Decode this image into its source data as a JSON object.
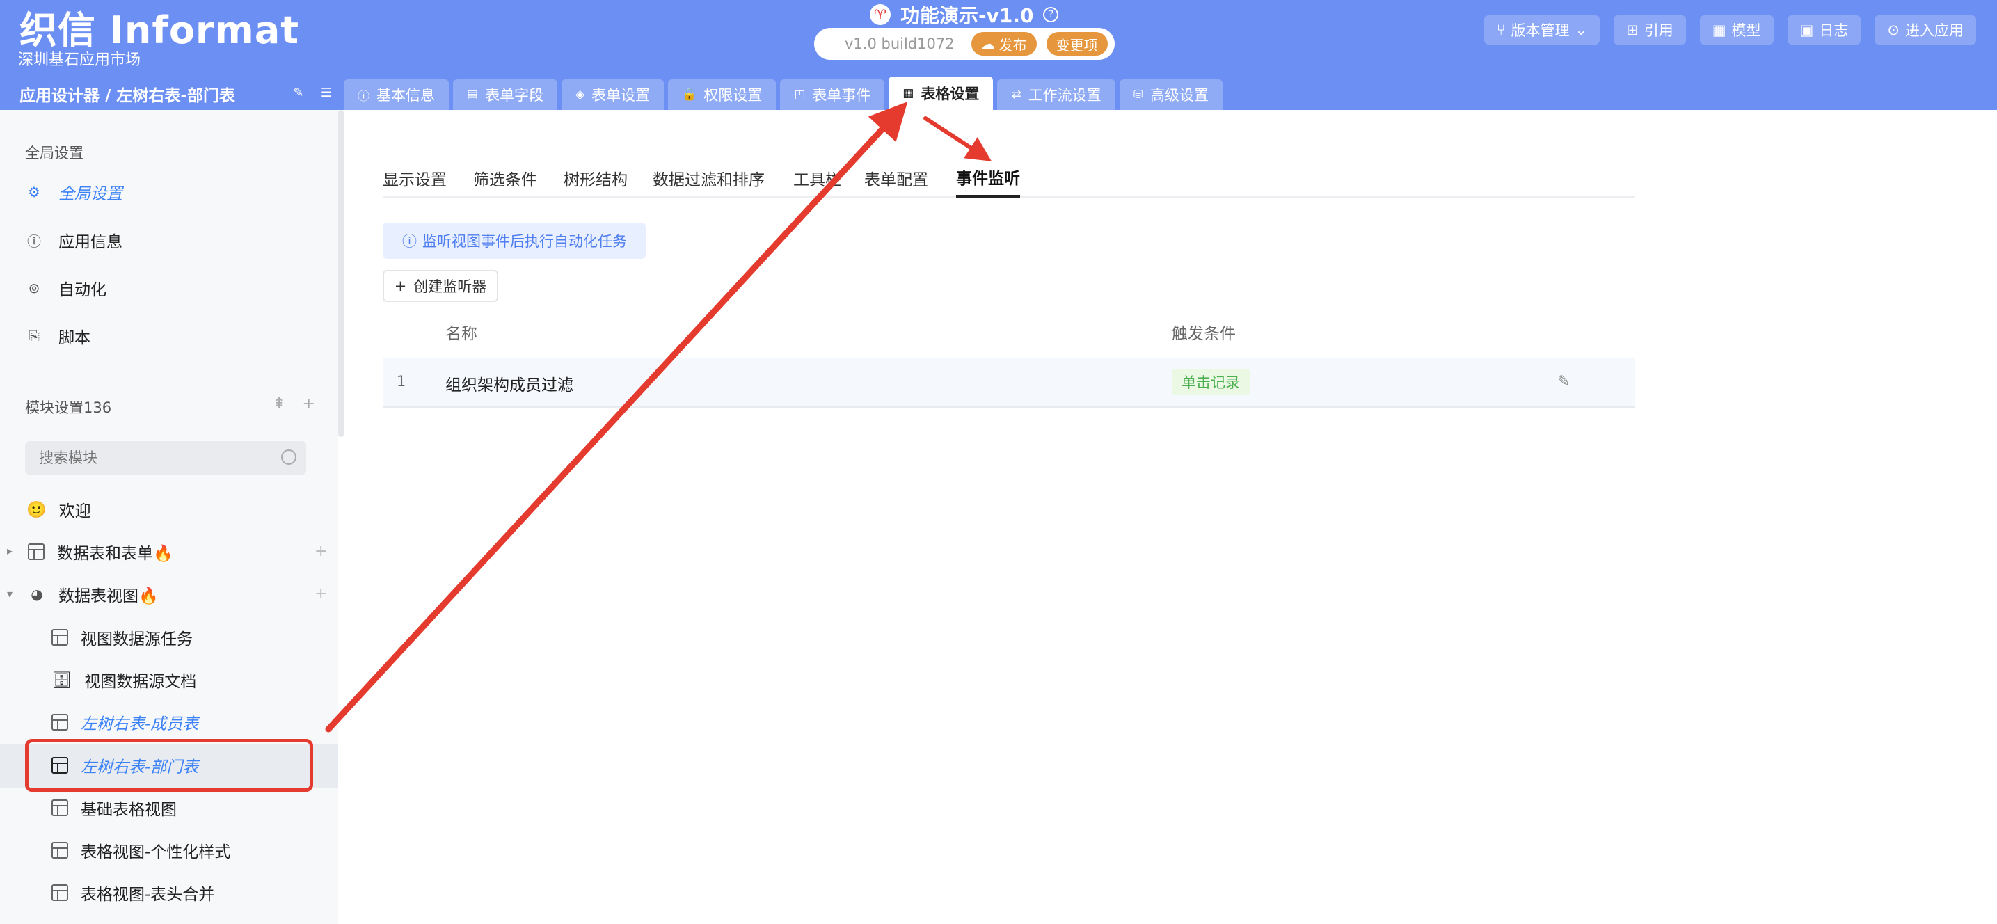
{
  "header": {
    "logo": "织信 Informat",
    "logo_sub": "深圳基石应用市场",
    "app_icon": "♈",
    "app_title": "功能演示-v1.0",
    "help": "?",
    "version": "v1.0 build1072",
    "publish_label": "发布",
    "changes_label": "变更项",
    "right_buttons": [
      {
        "icon": "branch-icon",
        "label": "版本管理"
      },
      {
        "icon": "reference-icon",
        "label": "引用"
      },
      {
        "icon": "model-icon",
        "label": "模型"
      },
      {
        "icon": "log-icon",
        "label": "日志"
      },
      {
        "icon": "enter-icon",
        "label": "进入应用"
      }
    ],
    "breadcrumb": "应用设计器 / 左树右表-部门表",
    "main_tabs": [
      {
        "icon": "ⓘ",
        "label": "基本信息"
      },
      {
        "icon": "▤",
        "label": "表单字段"
      },
      {
        "icon": "◈",
        "label": "表单设置"
      },
      {
        "icon": "🔒",
        "label": "权限设置"
      },
      {
        "icon": "◰",
        "label": "表单事件"
      },
      {
        "icon": "▦",
        "label": "表格设置"
      },
      {
        "icon": "⇄",
        "label": "工作流设置"
      },
      {
        "icon": "⛁",
        "label": "高级设置"
      }
    ]
  },
  "sidebar": {
    "global_section": "全局设置",
    "global_items": [
      {
        "icon": "⚙",
        "label": "全局设置"
      },
      {
        "icon": "ⓘ",
        "label": "应用信息"
      },
      {
        "icon": "⊚",
        "label": "自动化"
      },
      {
        "icon": "⎘",
        "label": "脚本"
      }
    ],
    "module_section": "模块设置136",
    "search_placeholder": "搜索模块",
    "tree": [
      {
        "icon": "🙂",
        "label": "欢迎"
      },
      {
        "label": "数据表和表单🔥"
      },
      {
        "label": "数据表视图🔥"
      },
      {
        "label": "视图数据源任务"
      },
      {
        "icon": "🗄",
        "label": "视图数据源文档"
      },
      {
        "label": "左树右表-成员表"
      },
      {
        "label": "左树右表-部门表"
      },
      {
        "label": "基础表格视图"
      },
      {
        "label": "表格视图-个性化样式"
      },
      {
        "label": "表格视图-表头合并"
      }
    ]
  },
  "content": {
    "sub_tabs": [
      "显示设置",
      "筛选条件",
      "树形结构",
      "数据过滤和排序",
      "工具栏",
      "表单配置",
      "事件监听"
    ],
    "info": "监听视图事件后执行自动化任务",
    "create_label": "创建监听器",
    "columns": [
      "名称",
      "触发条件"
    ],
    "rows": [
      {
        "index": "1",
        "name": "组织架构成员过滤",
        "trigger": "单击记录"
      }
    ]
  },
  "colors": {
    "header_bg": "#6b8ff2",
    "accent": "#3b82f6",
    "annotation": "#e53a2e",
    "badge_green": "#4caf50"
  }
}
